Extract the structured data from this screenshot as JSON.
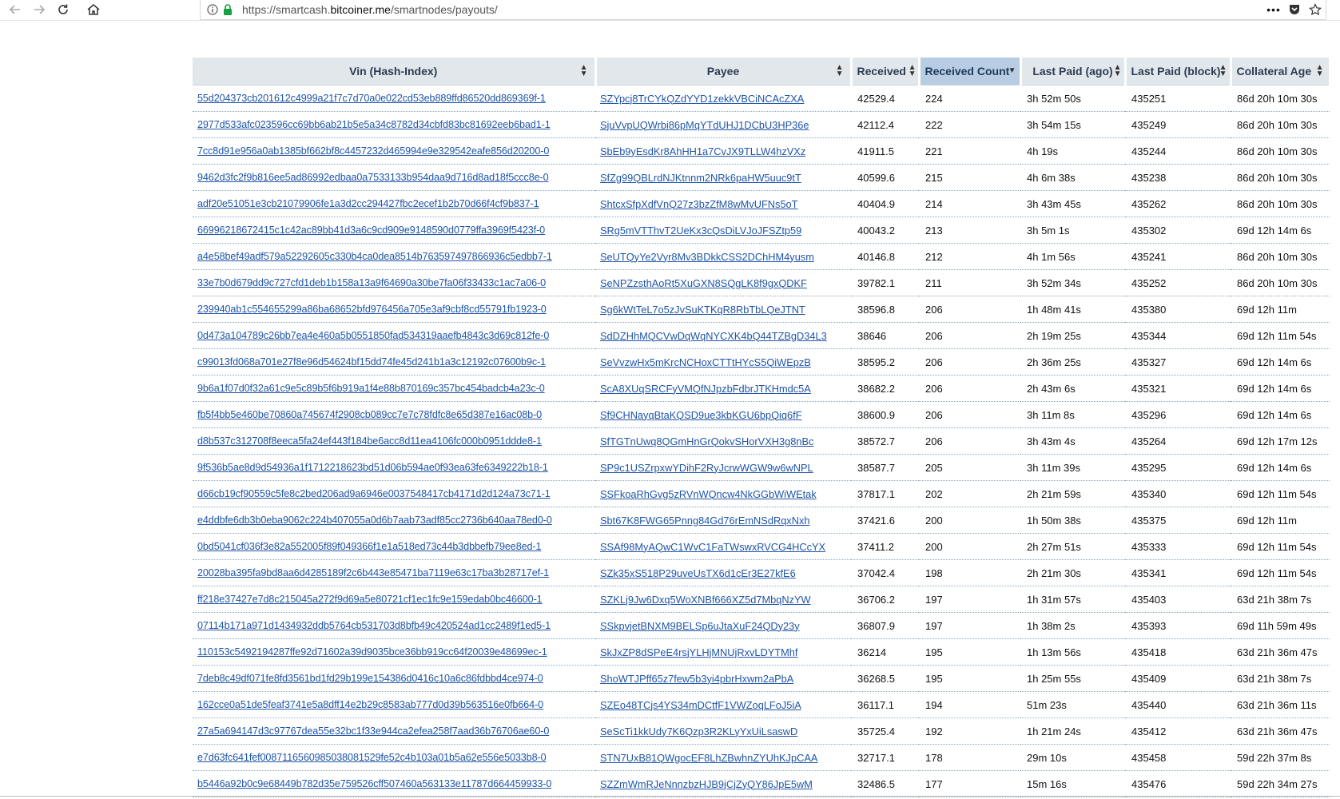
{
  "browser": {
    "url_prefix": "https://smartcash.",
    "url_domain": "bitcoiner.me",
    "url_path": "/smartnodes/payouts/",
    "menu_glyph": "•••"
  },
  "table": {
    "columns": [
      {
        "label": "Vin (Hash-Index)"
      },
      {
        "label": "Payee"
      },
      {
        "label": "Received"
      },
      {
        "label": "Received Count"
      },
      {
        "label": "Last Paid (ago)"
      },
      {
        "label": "Last Paid (block)"
      },
      {
        "label": "Collateral Age"
      }
    ],
    "sorted_column": "Received Count",
    "rows": [
      {
        "vin": "55d204373cb201612c4999a21f7c7d70a0e022cd53eb889ffd86520dd869369f-1",
        "payee": "SZYpcj8TrCYkQZdYYD1zekkVBCiNCAcZXA",
        "received": "42529.4",
        "count": "224",
        "ago": "3h 52m 50s",
        "block": "435251",
        "age": "86d 20h 10m 30s"
      },
      {
        "vin": "2977d533afc023596cc69bb6ab21b5e5a34c8782d34cbfd83bc81692eeb6bad1-1",
        "payee": "SjuVvpUQWrbi86pMqYTdUHJ1DCbU3HP36e",
        "received": "42112.4",
        "count": "222",
        "ago": "3h 54m 15s",
        "block": "435249",
        "age": "86d 20h 10m 30s"
      },
      {
        "vin": "7cc8d91e956a0ab1385bf662bf8c4457232d465994e9e329542eafe856d20200-0",
        "payee": "SbEb9yEsdKr8AhHH1a7CvJX9TLLW4hzVXz",
        "received": "41911.5",
        "count": "221",
        "ago": "4h 19s",
        "block": "435244",
        "age": "86d 20h 10m 30s"
      },
      {
        "vin": "9462d3fc2f9b816ee5ad86992edbaa0a7533133b954daa9d716d8ad18f5ccc8e-0",
        "payee": "SfZg99QBLrdNJKtnnm2NRk6paHW5uuc9tT",
        "received": "40599.6",
        "count": "215",
        "ago": "4h 6m 38s",
        "block": "435238",
        "age": "86d 20h 10m 30s"
      },
      {
        "vin": "adf20e51051e3cb21079906fe1a3d2cc294427fbc2ecef1b2b70d66f4cf9b837-1",
        "payee": "ShtcxSfpXdfVnQ27z3bzZfM8wMvUFNs5oT",
        "received": "40404.9",
        "count": "214",
        "ago": "3h 43m 45s",
        "block": "435262",
        "age": "86d 20h 10m 30s"
      },
      {
        "vin": "66996218672415c1c42ac89bb41d3a6c9cd909e9148590d0779ffa3969f5423f-0",
        "payee": "SRg5mVTThvT2UeKx3cQsDiLVJoJFSZtp59",
        "received": "40043.2",
        "count": "213",
        "ago": "3h 5m 1s",
        "block": "435302",
        "age": "69d 12h 14m 6s"
      },
      {
        "vin": "a4e58bef49adf579a52292605c330b4ca0dea8514b763597497866936c5edbb7-1",
        "payee": "SeUTQyYe2Vyr8Mv3BDkkCSS2DChHM4yusm",
        "received": "40146.8",
        "count": "212",
        "ago": "4h 1m 56s",
        "block": "435241",
        "age": "86d 20h 10m 30s"
      },
      {
        "vin": "33e7b0d679dd9c727cfd1deb1b158a13a9f64690a30be7fa06f33433c1ac7a06-0",
        "payee": "SeNPZzsthAoRt5XuGXN8SQgLK8f9gxQDKF",
        "received": "39782.1",
        "count": "211",
        "ago": "3h 52m 34s",
        "block": "435252",
        "age": "86d 20h 10m 30s"
      },
      {
        "vin": "239940ab1c554655299a86ba68652bfd976456a705e3af9cbf8cd55791fb1923-0",
        "payee": "Sg6kWtTeL7o5zJvSuKTKqR8RbTbLQeJTNT",
        "received": "38596.8",
        "count": "206",
        "ago": "1h 48m 41s",
        "block": "435380",
        "age": "69d 12h 11m"
      },
      {
        "vin": "0d473a104789c26bb7ea4e460a5b0551850fad534319aaefb4843c3d69c812fe-0",
        "payee": "SdDZHhMQCVwDqWqNYCXK4bQ44TZBgD34L3",
        "received": "38646",
        "count": "206",
        "ago": "2h 19m 25s",
        "block": "435344",
        "age": "69d 12h 11m 54s"
      },
      {
        "vin": "c99013fd068a701e27f8e96d54624bf15dd74fe45d241b1a3c12192c07600b9c-1",
        "payee": "SeVvzwHx5mKrcNCHoxCTTtHYcS5QiWEpzB",
        "received": "38595.2",
        "count": "206",
        "ago": "2h 36m 25s",
        "block": "435327",
        "age": "69d 12h 14m 6s"
      },
      {
        "vin": "9b6a1f07d0f32a61c9e5c89b5f6b919a1f4e88b870169c357bc454badcb4a23c-0",
        "payee": "ScA8XUqSRCFyVMQfNJpzbFdbrJTKHmdc5A",
        "received": "38682.2",
        "count": "206",
        "ago": "2h 43m 6s",
        "block": "435321",
        "age": "69d 12h 14m 6s"
      },
      {
        "vin": "fb5f4bb5e460be70860a745674f2908cb089cc7e7c78fdfc8e65d387e16ac08b-0",
        "payee": "Sf9CHNayqBtaKQSD9ue3kbKGU6bpQiq6fF",
        "received": "38600.9",
        "count": "206",
        "ago": "3h 11m 8s",
        "block": "435296",
        "age": "69d 12h 14m 6s"
      },
      {
        "vin": "d8b537c312708f8eeca5fa24ef443f184be6acc8d11ea4106fc000b0951ddde8-1",
        "payee": "SfTGTnUwq8QGmHnGrQokvSHorVXH3g8nBc",
        "received": "38572.7",
        "count": "206",
        "ago": "3h 43m 4s",
        "block": "435264",
        "age": "69d 12h 17m 12s"
      },
      {
        "vin": "9f536b5ae8d9d54936a1f1712218623bd51d06b594ae0f93ea63fe6349222b18-1",
        "payee": "SP9c1USZrpxwYDihF2RyJcrwWGW9w6wNPL",
        "received": "38587.7",
        "count": "205",
        "ago": "3h 11m 39s",
        "block": "435295",
        "age": "69d 12h 14m 6s"
      },
      {
        "vin": "d66cb19cf90559c5fe8c2bed206ad9a6946e0037548417cb4171d2d124a73c71-1",
        "payee": "SSFkoaRhGvg5zRVnWQncw4NkGGbWiWEtak",
        "received": "37817.1",
        "count": "202",
        "ago": "2h 21m 59s",
        "block": "435340",
        "age": "69d 12h 11m 54s"
      },
      {
        "vin": "e4ddbfe6db3b0eba9062c224b407055a0d6b7aab73adf85cc2736b640aa78ed0-0",
        "payee": "Sbt67K8FWG65Pnng84Gd76rEmNSdRqxNxh",
        "received": "37421.6",
        "count": "200",
        "ago": "1h 50m 38s",
        "block": "435375",
        "age": "69d 12h 11m"
      },
      {
        "vin": "0bd5041cf036f3e82a552005f89f049366f1e1a518ed73c44b3dbbefb79ee8ed-1",
        "payee": "SSAf98MyAQwC1WvC1FaTWswxRVCG4HCcYX",
        "received": "37411.2",
        "count": "200",
        "ago": "2h 27m 51s",
        "block": "435333",
        "age": "69d 12h 11m 54s"
      },
      {
        "vin": "20028ba395fa9bd8aa6d4285189f2c6b443e85471ba7119e63c17ba3b28717ef-1",
        "payee": "SZk35xS518P29uveUsTX6d1cEr3E27kfE6",
        "received": "37042.4",
        "count": "198",
        "ago": "2h 21m 30s",
        "block": "435341",
        "age": "69d 12h 11m 54s"
      },
      {
        "vin": "ff218e37427e7d8c215045a272f9d69a5e80721cf1ec1fc9e159edab0bc46600-1",
        "payee": "SZKLj9Jw6Dxq5WoXNBf666XZ5d7MbqNzYW",
        "received": "36706.2",
        "count": "197",
        "ago": "1h 31m 57s",
        "block": "435403",
        "age": "63d 21h 38m 7s"
      },
      {
        "vin": "07114b171a971d1434932ddb5764cb531703d8bfb49c420524ad1cc2489f1ed5-1",
        "payee": "SSkpvjetBNXM9BELSp6uJtaXuF24QDy23y",
        "received": "36807.9",
        "count": "197",
        "ago": "1h 38m 2s",
        "block": "435393",
        "age": "69d 11h 59m 49s"
      },
      {
        "vin": "110153c5492194287ffe92d71602a39d9035bce36bb919cc64f20039e48699ec-1",
        "payee": "SkJxZP8dSPeE4rsjYLHjMNUjRxvLDYTMhf",
        "received": "36214",
        "count": "195",
        "ago": "1h 13m 56s",
        "block": "435418",
        "age": "63d 21h 36m 47s"
      },
      {
        "vin": "7deb8c49df071fe8fd3561bd1fd29b199e154386d0416c10a6c86fdbbd4ce974-0",
        "payee": "ShoWTJPff65z7few5b3yi4pbrHxwm2aPbA",
        "received": "36268.5",
        "count": "195",
        "ago": "1h 25m 55s",
        "block": "435409",
        "age": "63d 21h 38m 7s"
      },
      {
        "vin": "162cce0a51de5feaf3741e5a8dff14e2b29c8583ab777d0d39b563516e0fb664-0",
        "payee": "SZEo48TCjs4YS34mDCtfF1VWZoqLFoJ5iA",
        "received": "36117.1",
        "count": "194",
        "ago": "51m 23s",
        "block": "435440",
        "age": "63d 21h 36m 11s"
      },
      {
        "vin": "27a5a694147d3c97767dea55e32bc1f33e944ca2efea258f7aad36b76706ae60-0",
        "payee": "SeScTi1kkUdy7K6Qzp3R2KLyYxUiLsaswD",
        "received": "35725.4",
        "count": "192",
        "ago": "1h 21m 24s",
        "block": "435412",
        "age": "63d 21h 36m 47s"
      },
      {
        "vin": "e7d63fc641fef0087116560985038081529fe52c4b103a01b5a62e556e5033b8-0",
        "payee": "STN7UxB81QWgocEF8LhZBwhnZYUhKJpCAA",
        "received": "32717.1",
        "count": "178",
        "ago": "29m 10s",
        "block": "435458",
        "age": "59d 22h 37m 8s"
      },
      {
        "vin": "b5446a92b0c9e68449b782d35e759526cff507460a563133e11787d664459933-0",
        "payee": "SZZmWmRJeNnnzbzHJB9jCjZyQY86JpE5wM",
        "received": "32486.5",
        "count": "177",
        "ago": "15m 16s",
        "block": "435476",
        "age": "59d 22h 34m 27s"
      }
    ]
  }
}
